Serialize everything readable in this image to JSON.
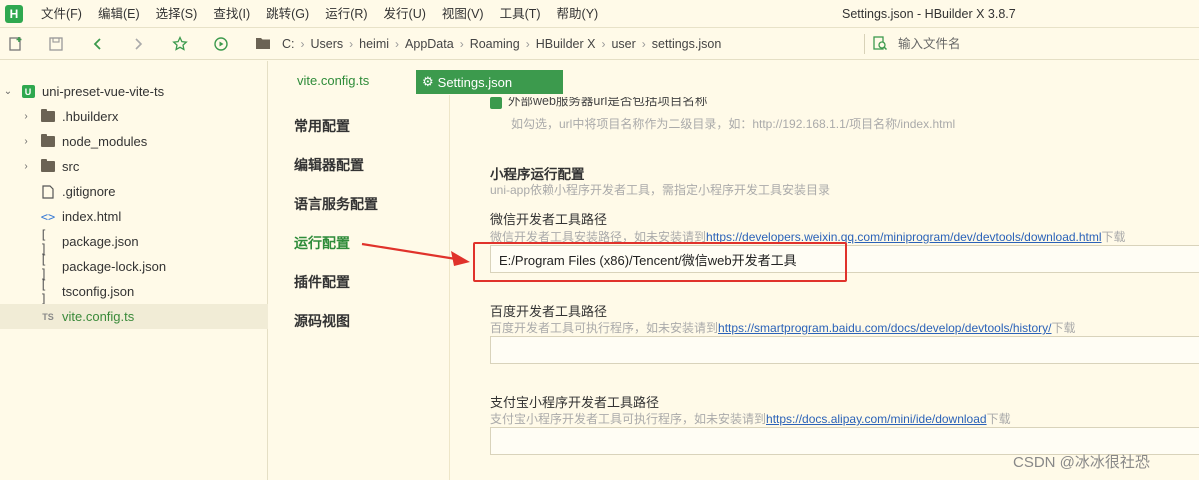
{
  "app": {
    "logo_letter": "H",
    "window_title": "Settings.json - HBuilder X 3.8.7"
  },
  "menu": [
    "文件(F)",
    "编辑(E)",
    "选择(S)",
    "查找(I)",
    "跳转(G)",
    "运行(R)",
    "发行(U)",
    "视图(V)",
    "工具(T)",
    "帮助(Y)"
  ],
  "breadcrumb": [
    "C:",
    "Users",
    "heimi",
    "AppData",
    "Roaming",
    "HBuilder X",
    "user",
    "settings.json"
  ],
  "search": {
    "placeholder": "输入文件名"
  },
  "project": {
    "name": "uni-preset-vue-vite-ts",
    "items": [
      {
        "label": ".hbuilderx",
        "kind": "folder"
      },
      {
        "label": "node_modules",
        "kind": "folder"
      },
      {
        "label": "src",
        "kind": "folder"
      },
      {
        "label": ".gitignore",
        "kind": "file"
      },
      {
        "label": "index.html",
        "kind": "html"
      },
      {
        "label": "package.json",
        "kind": "json"
      },
      {
        "label": "package-lock.json",
        "kind": "json"
      },
      {
        "label": "tsconfig.json",
        "kind": "json"
      },
      {
        "label": "vite.config.ts",
        "kind": "ts"
      }
    ]
  },
  "tabs": [
    {
      "label": "vite.config.ts",
      "active": false
    },
    {
      "label": "Settings.json",
      "active": true
    }
  ],
  "settings_nav": [
    "常用配置",
    "编辑器配置",
    "语言服务配置",
    "运行配置",
    "插件配置",
    "源码视图"
  ],
  "settings_nav_active": "运行配置",
  "content": {
    "cut_option_label": "外部web服务器url是否包括项目名称",
    "cut_option_hint": "如勾选，url中将项目名称作为二级目录，如：http://192.168.1.1/项目名称/index.html",
    "section_title": "小程序运行配置",
    "section_hint": "uni-app依赖小程序开发者工具，需指定小程序开发工具安装目录",
    "wechat": {
      "label": "微信开发者工具路径",
      "hint_prefix": "微信开发者工具安装路径，如未安装请到",
      "hint_link": "https://developers.weixin.qq.com/miniprogram/dev/devtools/download.html",
      "hint_suffix": "下载",
      "value": "E:/Program Files (x86)/Tencent/微信web开发者工具"
    },
    "baidu": {
      "label": "百度开发者工具路径",
      "hint_prefix": "百度开发者工具可执行程序，如未安装请到",
      "hint_link": "https://smartprogram.baidu.com/docs/develop/devtools/history/",
      "hint_suffix": "下载",
      "value": ""
    },
    "alipay": {
      "label": "支付宝小程序开发者工具路径",
      "hint_prefix": "支付宝小程序开发者工具可执行程序，如未安装请到",
      "hint_link": "https://docs.alipay.com/mini/ide/download",
      "hint_suffix": "下载",
      "value": ""
    }
  },
  "watermark": "CSDN @冰冰很社恐",
  "colors": {
    "background": "#fffae8",
    "accent_green": "#3c9a4d",
    "link_blue": "#2b62b8",
    "annotation_red": "#e0322b"
  }
}
